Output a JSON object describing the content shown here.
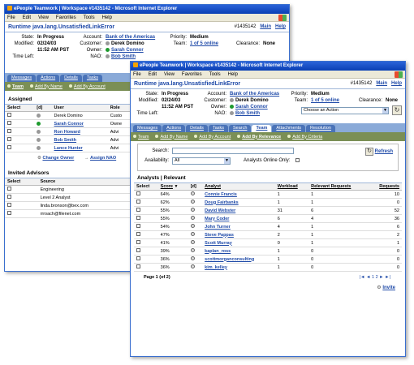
{
  "back": {
    "title": "ePeople Teamwork | Workspace #1435142 - Microsoft Internet Explorer",
    "menu": [
      "File",
      "Edit",
      "View",
      "Favorites",
      "Tools",
      "Help"
    ],
    "page_title": "Runtime java.lang.UnsatisfiedLinkError",
    "ticket": "#1435142",
    "links": [
      "Main",
      "Help"
    ],
    "state_label": "State:",
    "state": "In Progress",
    "modified_label": "Modified:",
    "modified_date": "02/24/03",
    "modified_time": "11:52 AM PST",
    "timeleft_label": "Time Left:",
    "account_label": "Account:",
    "account": "Bank of the Americas",
    "customer_label": "Customer:",
    "customer": "Derek Domino",
    "owner_label": "Owner:",
    "owner": "Sarah Connor",
    "nao_label": "NAO:",
    "nao": "Bob Smith",
    "priority_label": "Priority:",
    "priority": "Medium",
    "team_label": "Team:",
    "team": "1 of 5 online",
    "clearance_label": "Clearance:",
    "clearance": "None",
    "tabs": [
      "Messages",
      "Actions",
      "Details",
      "Tasks"
    ],
    "subtabs": [
      "Team",
      "Add By Name",
      "Add By Account"
    ],
    "assigned_header": "Assigned",
    "assigned_cols": [
      "Select",
      "[d]",
      "User",
      "Role"
    ],
    "assigned_rows": [
      {
        "user": "Derek Domino",
        "role": "Custo",
        "link": false,
        "dot": "gray"
      },
      {
        "user": "Sarah Connor",
        "role": "Owne",
        "link": true,
        "dot": "green"
      },
      {
        "user": "Ron Howard",
        "role": "Advi",
        "link": true,
        "dot": "gray"
      },
      {
        "user": "Bob Smith",
        "role": "Advi",
        "link": true,
        "dot": "gray"
      },
      {
        "user": "Lance Hunter",
        "role": "Advi",
        "link": true,
        "dot": "gray"
      }
    ],
    "change_owner": "Change Owner",
    "assign_nao": "Assign NAO",
    "invited_header": "Invited Advisors",
    "invited_cols": [
      "Select",
      "Source"
    ],
    "invited_rows": [
      "Engineering",
      "Level 2 Analyst",
      "linda.bronson@bex.com",
      "rrroach@filenet.com"
    ]
  },
  "front": {
    "title": "ePeople Teamwork | Workspace #1435142 - Microsoft Internet Explorer",
    "menu": [
      "File",
      "Edit",
      "View",
      "Favorites",
      "Tools",
      "Help"
    ],
    "page_title": "Runtime java.lang.UnsatisfiedLinkError",
    "ticket": "#1435142",
    "links": [
      "Main",
      "Help"
    ],
    "state_label": "State:",
    "state": "In Progress",
    "modified_label": "Modified:",
    "modified_date": "02/24/03",
    "modified_time": "11:52 AM PST",
    "timeleft_label": "Time Left:",
    "account_label": "Account:",
    "account": "Bank of the Americas",
    "customer_label": "Customer:",
    "customer": "Derek Domino",
    "owner_label": "Owner:",
    "owner": "Sarah Connor",
    "nao_label": "NAO:",
    "nao": "Bob Smith",
    "priority_label": "Priority:",
    "priority": "Medium",
    "team_label": "Team:",
    "team": "1 of 5 online",
    "clearance_label": "Clearance:",
    "clearance": "None",
    "action_select": "Choose an Action",
    "tabs": [
      "Messages",
      "Actions",
      "Details",
      "Tasks",
      "Search",
      "Team",
      "Attachments",
      "Resolution"
    ],
    "active_tab": 5,
    "subtabs": [
      "Team",
      "Add By Name",
      "Add By Account",
      "Add By Relevance",
      "Add By Criteria"
    ],
    "active_subtab": 3,
    "search_label": "Search:",
    "availability_label": "Availability:",
    "availability_value": "All",
    "online_only_label": "Analysts Online Only:",
    "refresh": "Refresh",
    "results_header": "Analysts | Relevant",
    "cols": [
      "Select",
      "Score",
      "[d]",
      "Analyst",
      "Workload",
      "Relevant Requests",
      "Requests"
    ],
    "rows": [
      {
        "score": "64%",
        "analyst": "Connie Francis",
        "workload": "1",
        "relevant": "1",
        "requests": "10"
      },
      {
        "score": "62%",
        "analyst": "Doug Fairbanks",
        "workload": "1",
        "relevant": "1",
        "requests": "0"
      },
      {
        "score": "55%",
        "analyst": "David Webster",
        "workload": "31",
        "relevant": "6",
        "requests": "52"
      },
      {
        "score": "55%",
        "analyst": "Mary Coder",
        "workload": "6",
        "relevant": "4",
        "requests": "36"
      },
      {
        "score": "54%",
        "analyst": "John Turner",
        "workload": "4",
        "relevant": "1",
        "requests": "6"
      },
      {
        "score": "47%",
        "analyst": "Steve Pappas",
        "workload": "2",
        "relevant": "1",
        "requests": "2"
      },
      {
        "score": "41%",
        "analyst": "Scott Murray",
        "workload": "0",
        "relevant": "1",
        "requests": "1"
      },
      {
        "score": "39%",
        "analyst": "kaplan_ross",
        "workload": "1",
        "relevant": "0",
        "requests": "0"
      },
      {
        "score": "36%",
        "analyst": "scottmorganconsulting",
        "workload": "1",
        "relevant": "0",
        "requests": "0"
      },
      {
        "score": "36%",
        "analyst": "kim_kelley",
        "workload": "1",
        "relevant": "0",
        "requests": "0"
      }
    ],
    "page_info": "Page 1 (of 2)",
    "pager": "|◄ ◄ 1 2 ► ►|",
    "invite": "Invite"
  }
}
